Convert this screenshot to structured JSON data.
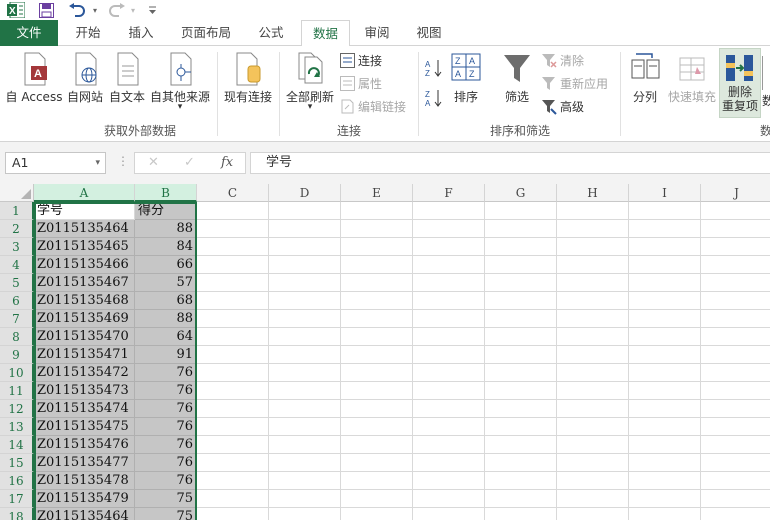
{
  "qat": {
    "app_icon": "excel-logo-icon",
    "save_icon": "save-icon",
    "undo_icon": "undo-icon",
    "redo_icon": "redo-icon",
    "customize_icon": "customize-qat-icon"
  },
  "tabs": {
    "file": "文件",
    "items": [
      "开始",
      "插入",
      "页面布局",
      "公式",
      "数据",
      "审阅",
      "视图"
    ],
    "active": "数据"
  },
  "ribbon": {
    "get_external": {
      "from_access": "自 Access",
      "from_web": "自网站",
      "from_text": "自文本",
      "from_other": "自其他来源",
      "dropdown": "▾",
      "existing": "现有连接",
      "label": "获取外部数据"
    },
    "connections": {
      "refresh_all": "全部刷新",
      "dropdown": "▾",
      "connections": "连接",
      "properties": "属性",
      "edit_links": "编辑链接",
      "label": "连接"
    },
    "sort_filter": {
      "sort": "排序",
      "filter": "筛选",
      "clear": "清除",
      "reapply": "重新应用",
      "advanced": "高级",
      "label": "排序和筛选"
    },
    "data_tools": {
      "text_to_columns": "分列",
      "flash_fill": "快速填充",
      "remove_dup_line1": "删除",
      "remove_dup_line2": "重复项",
      "cut_label": "数",
      "label": "数"
    }
  },
  "formula_bar": {
    "name_box": "A1",
    "name_box_arrow": "▾",
    "dots": "⋮",
    "cancel": "✕",
    "enter": "✓",
    "fx": "fx",
    "content": "学号"
  },
  "sheet": {
    "columns": [
      "A",
      "B",
      "C",
      "D",
      "E",
      "F",
      "G",
      "H",
      "I",
      "J"
    ],
    "selected_columns": [
      "A",
      "B"
    ],
    "rows": [
      {
        "n": "1",
        "a": "学号",
        "b": "得分"
      },
      {
        "n": "2",
        "a": "Z0115135464",
        "b": "88"
      },
      {
        "n": "3",
        "a": "Z0115135465",
        "b": "84"
      },
      {
        "n": "4",
        "a": "Z0115135466",
        "b": "66"
      },
      {
        "n": "5",
        "a": "Z0115135467",
        "b": "57"
      },
      {
        "n": "6",
        "a": "Z0115135468",
        "b": "68"
      },
      {
        "n": "7",
        "a": "Z0115135469",
        "b": "88"
      },
      {
        "n": "8",
        "a": "Z0115135470",
        "b": "64"
      },
      {
        "n": "9",
        "a": "Z0115135471",
        "b": "91"
      },
      {
        "n": "10",
        "a": "Z0115135472",
        "b": "76"
      },
      {
        "n": "11",
        "a": "Z0115135473",
        "b": "76"
      },
      {
        "n": "12",
        "a": "Z0115135474",
        "b": "76"
      },
      {
        "n": "13",
        "a": "Z0115135475",
        "b": "76"
      },
      {
        "n": "14",
        "a": "Z0115135476",
        "b": "76"
      },
      {
        "n": "15",
        "a": "Z0115135477",
        "b": "76"
      },
      {
        "n": "16",
        "a": "Z0115135478",
        "b": "76"
      },
      {
        "n": "17",
        "a": "Z0115135479",
        "b": "75"
      },
      {
        "n": "18",
        "a": "Z0115135464",
        "b": "75"
      }
    ]
  },
  "colors": {
    "accent": "#217346",
    "selection_fill": "#c6c6c6",
    "disabled_text": "#a6a6a6"
  }
}
